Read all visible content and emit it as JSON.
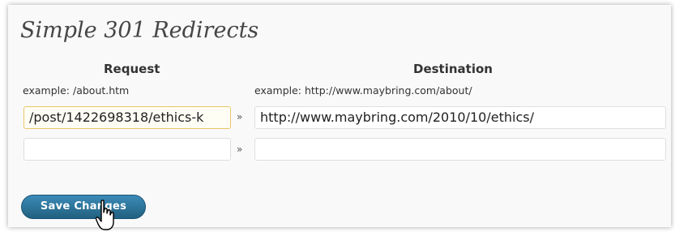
{
  "page": {
    "title": "Simple 301 Redirects"
  },
  "columns": {
    "request_header": "Request",
    "destination_header": "Destination",
    "request_example": "example: /about.htm",
    "destination_example": "example: http://www.maybring.com/about/"
  },
  "rows": [
    {
      "request_value": "/post/1422698318/ethics-k",
      "separator": "»",
      "destination_value": "http://www.maybring.com/2010/10/ethics/"
    },
    {
      "request_value": "",
      "separator": "»",
      "destination_value": ""
    }
  ],
  "actions": {
    "save_label": "Save Changes"
  },
  "icons": {
    "cursor": "hand-pointer-icon"
  },
  "colors": {
    "button_top": "#3b8bb8",
    "button_bottom": "#21607f",
    "focus_border": "#e8c76a"
  }
}
